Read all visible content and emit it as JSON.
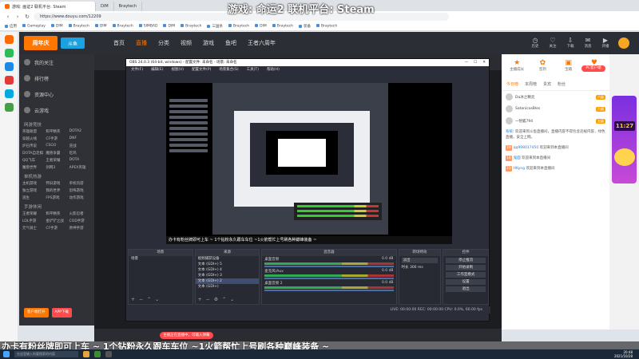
{
  "browser": {
    "tabs": [
      {
        "label": "游戏: 画证2 联机平台: Steam"
      },
      {
        "label": "DIM"
      },
      {
        "label": "Braytech"
      }
    ],
    "url": "https://www.douyu.com/12209",
    "bookmarks": [
      "应用",
      "Gameplay",
      "DIM",
      "Braytech",
      "DIM",
      "Braytech",
      "SIMBAD",
      "DIM",
      "Braytech",
      "三国杀",
      "Braytech",
      "DIM",
      "Braytech",
      "装备",
      "Braytech"
    ]
  },
  "overlay_title": "游戏: 命运2 联机平台: Steam",
  "douyu": {
    "logo": "周年庆",
    "logo2": "斗鱼",
    "nav": [
      "首页",
      "直播",
      "分类",
      "视频",
      "游戏",
      "鱼吧",
      "王者六周年"
    ],
    "header_icons": [
      {
        "icon": "history-icon",
        "label": "历史"
      },
      {
        "icon": "follow-icon",
        "label": "关注"
      },
      {
        "icon": "download-icon",
        "label": "下载"
      },
      {
        "icon": "message-icon",
        "label": "消息"
      },
      {
        "icon": "live-icon",
        "label": "开播"
      }
    ],
    "sidebar": {
      "items": [
        "我的关注",
        "排行榜",
        "资源中心",
        "云游戏"
      ],
      "section1": "网游竞技",
      "grid1": [
        "英雄联盟",
        "和平精英",
        "DOTA2",
        "穿越火线",
        "CF手游",
        "DNF",
        "炉石传说",
        "CSGO",
        "逆战",
        "DOTA自走棋",
        "魔兽争霸",
        "吃鸡",
        "QQ飞车",
        "王者荣耀",
        "DOTA",
        "魔兽世界",
        "剑网3",
        "APEX英雄"
      ],
      "section2": "单机热游",
      "grid2": [
        "主机游戏",
        "怀旧游戏",
        "单机热游",
        "独立游戏",
        "我的世界",
        "恐怖游戏",
        "逃生",
        "FPS游戏",
        "动作游戏"
      ],
      "section3": "手游休闲",
      "grid3": [
        "王者荣耀",
        "和平精英",
        "火影忍者",
        "LOL手游",
        "金铲铲之战",
        "COD手游",
        "元气骑士",
        "CF手游",
        "原神手游"
      ],
      "btn_client": "客户端打开",
      "btn_download": "APP下载"
    }
  },
  "obs": {
    "title": "OBS 24.0.3 (64-bit, windows) - 配置文件: 未命名 - 场景: 未命名",
    "menu": [
      "文件(F)",
      "编辑(E)",
      "视图(V)",
      "配置文件(P)",
      "场景集合(S)",
      "工具(T)",
      "帮助(H)"
    ],
    "caption": "办卡有粉丝牌即可上车 ~ 1个钻粉永久跟车车位 ~1火箭帮忙上号刷各种巅峰装备 ~",
    "docks": {
      "scenes_title": "场景",
      "scenes": [
        "场景"
      ],
      "sources_title": "来源",
      "sources": [
        "视频捕获设备",
        "文本 (GDI+) 5",
        "文本 (GDI+) 4",
        "文本 (GDI+) 3",
        "文本 (GDI+) 2",
        "文本 (GDI+)"
      ],
      "mixer_title": "混音器",
      "mixer": [
        {
          "name": "桌面音频",
          "db": "0.0 dB"
        },
        {
          "name": "麦克风/Aux",
          "db": "0.0 dB"
        },
        {
          "name": "桌面音频 2",
          "db": "0.0 dB"
        }
      ],
      "trans_title": "转场特效",
      "trans_type": "淡出",
      "trans_label": "时长",
      "trans_duration": "300 ms",
      "controls_title": "控件",
      "controls": [
        "停止推流",
        "开始录制",
        "工作室模式",
        "设置",
        "退出"
      ]
    },
    "status": "LIVE: 00:00:00   REC: 00:00:00   CPU: 0.0%, 60.00 fps"
  },
  "right_panel": {
    "rank_buttons": [
      {
        "icon": "rank-icon",
        "label": "主播成长"
      },
      {
        "icon": "gift-icon",
        "label": "签到"
      },
      {
        "icon": "box-icon",
        "label": "宝箱"
      },
      {
        "icon": "fans-icon",
        "label": "粉丝团"
      }
    ],
    "pc_button": "PC客户端",
    "tabs": [
      "今日榜",
      "本周榜",
      "贵宾",
      "粉丝"
    ],
    "ranks": [
      {
        "name": "Da冰之精灵",
        "badge": "六级"
      },
      {
        "name": "SatanicosBles",
        "badge": "六级"
      },
      {
        "name": "一悟狐794",
        "badge": "五级"
      }
    ],
    "chat": [
      {
        "lv": "",
        "nick": "系统",
        "text": "欢迎来到斗鱼直播间，直播内容不得包含违规内容，绿色直播，安全上网。"
      },
      {
        "lv": "19",
        "nick": "qq998017450",
        "text": "欢迎来到本直播间"
      },
      {
        "lv": "18",
        "nick": "鬼面",
        "text": "欢迎来到本直播间"
      },
      {
        "lv": "15",
        "nick": "HKyng",
        "text": "欢迎来到本直播间"
      }
    ]
  },
  "promo": {
    "clock": "11:27",
    "label": "火箭"
  },
  "stage_pill": "主播正在直播中，可输入弹幕",
  "ticker": "办卡有粉丝牌即可上车 ~ 1个钻粉永久跟车车位 ~1火箭帮忙上号刷各种巅峰装备 ~",
  "taskbar": {
    "search": "在这里输入你要搜索的内容",
    "time": "20:48",
    "date": "2021/10/28"
  },
  "colors": {
    "accent": "#ff7700",
    "obs_bg": "#2b2e38",
    "douyu_dark": "#2c2e35"
  }
}
